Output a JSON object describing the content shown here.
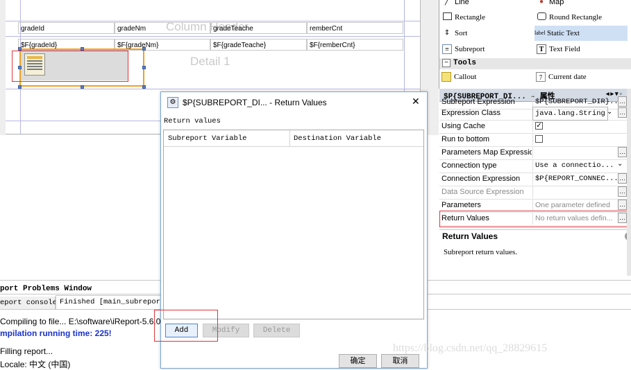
{
  "canvas": {
    "band_labels": {
      "column_header": "Column Header",
      "detail": "Detail 1"
    },
    "header_fields": [
      "gradeId",
      "gradeNm",
      "gradeTeache",
      "remberCnt"
    ],
    "detail_fields": [
      "$F{gradeId}",
      "$F{gradeNm}",
      "$F{gradeTeache}",
      "$F{remberCnt}"
    ]
  },
  "palette": {
    "items": [
      {
        "icon": "line-icon",
        "label": "Line"
      },
      {
        "icon": "map-icon",
        "label": "Map"
      },
      {
        "icon": "rectangle-icon",
        "label": "Rectangle"
      },
      {
        "icon": "round-rectangle-icon",
        "label": "Round Rectangle"
      },
      {
        "icon": "sort-icon",
        "label": "Sort"
      },
      {
        "icon": "static-text-icon",
        "label": "Static Text"
      },
      {
        "icon": "subreport-icon",
        "label": "Subreport"
      },
      {
        "icon": "text-field-icon",
        "label": "Text Field"
      }
    ],
    "tools_header": "Tools",
    "tools": [
      {
        "icon": "callout-icon",
        "label": "Callout"
      },
      {
        "icon": "calendar-icon",
        "label": "Current date"
      }
    ]
  },
  "properties": {
    "header": "$P{SUBREPORT_DI... - 属性",
    "rows": [
      {
        "name": "Subreport Expression",
        "value": "$P{SUBREPORT_DIR}..."
      },
      {
        "name": "Expression Class",
        "value": "java.lang.String"
      },
      {
        "name": "Using Cache",
        "value": ""
      },
      {
        "name": "Run to bottom",
        "value": ""
      },
      {
        "name": "Parameters Map Expression",
        "value": ""
      },
      {
        "name": "Connection type",
        "value": "Use a connectio..."
      },
      {
        "name": "Connection Expression",
        "value": "$P{REPORT_CONNEC..."
      },
      {
        "name": "Data Source Expression",
        "value": ""
      },
      {
        "name": "Parameters",
        "value": "One parameter defined"
      },
      {
        "name": "Return Values",
        "value": "No return values defin..."
      }
    ],
    "help_title": "Return Values",
    "help_text": "Subreport return values."
  },
  "output": {
    "title": "port Problems Window",
    "tab_console": "eport console",
    "tab_finished": "Finished [main_subreport",
    "lines": [
      "Compiling to file... E:\\software\\iReport-5.6.0",
      "mpilation running time: 225!",
      "Filling report...",
      "Locale: 中文 (中国)"
    ]
  },
  "dialog": {
    "title": "$P{SUBREPORT_DI... - Return Values",
    "section_label": "Return values",
    "columns": [
      "Subreport Variable",
      "Destination Variable"
    ],
    "buttons": {
      "add": "Add",
      "modify": "Modify",
      "delete": "Delete",
      "ok": "确定",
      "cancel": "取消"
    },
    "close_glyph": "✕"
  },
  "watermark": "https://blog.csdn.net/qq_28829615",
  "colors": {
    "accent_red": "#e0333a",
    "selection_blue": "#cfe0f5",
    "compile_blue": "#1a33c8"
  }
}
